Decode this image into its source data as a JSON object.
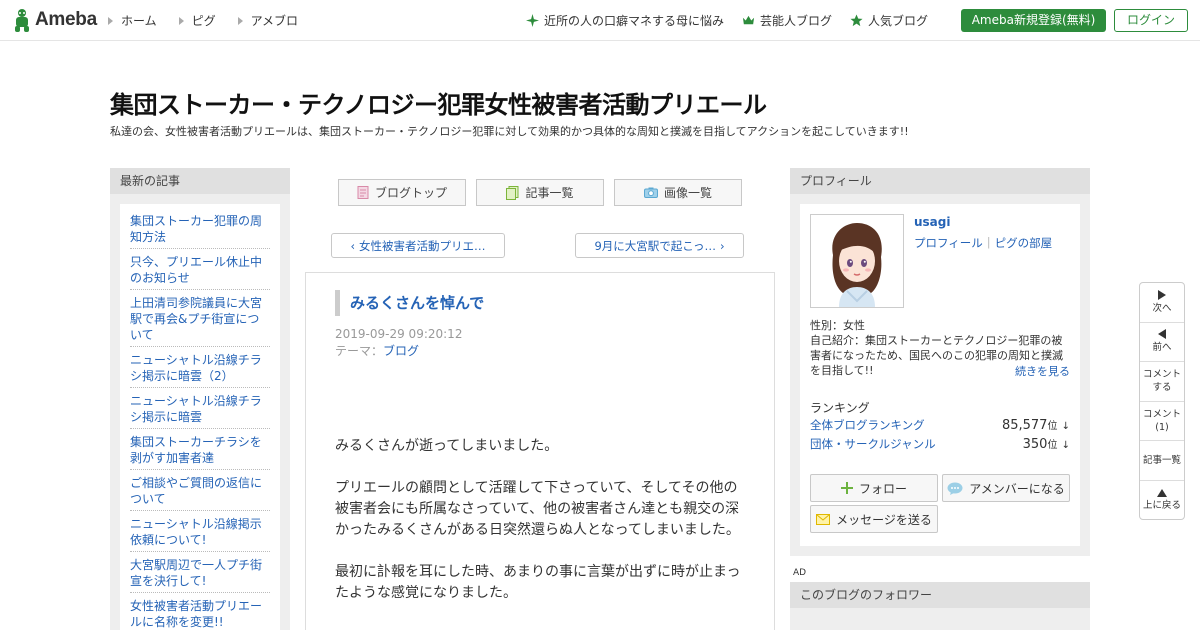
{
  "header": {
    "logo_text": "Ameba",
    "nav": [
      "ホーム",
      "ピグ",
      "アメブロ"
    ],
    "links": [
      {
        "icon": "sparkle-icon",
        "label": "近所の人の口癖マネする母に悩み"
      },
      {
        "icon": "crown-icon",
        "label": "芸能人ブログ"
      },
      {
        "icon": "star-icon",
        "label": "人気ブログ"
      }
    ],
    "register_label": "Ameba新規登録(無料)",
    "login_label": "ログイン",
    "accent_color": "#2d8c3c"
  },
  "blog": {
    "title": "集団ストーカー・テクノロジー犯罪女性被害者活動プリエール",
    "description": "私達の会、女性被害者活動プリエールは、集団ストーカー・テクノロジー犯罪に対して効果的かつ具体的な周知と撲滅を目指してアクションを起こしていきます!!"
  },
  "left_sidebar": {
    "heading": "最新の記事",
    "items": [
      "集団ストーカー犯罪の周知方法",
      "只今、プリエール休止中のお知らせ",
      "上田清司参院議員に大宮駅で再会&プチ街宣について",
      "ニューシャトル沿線チラシ掲示に暗雲（2）",
      "ニューシャトル沿線チラシ掲示に暗雲",
      "集団ストーカーチラシを剥がす加害者達",
      "ご相談やご質問の返信について",
      "ニューシャトル沿線掲示依頼について!",
      "大宮駅周辺で一人プチ街宣を決行して!",
      "女性被害者活動プリエールに名称を変更!!"
    ]
  },
  "tabs": [
    {
      "icon": "document-icon",
      "label": "ブログトップ"
    },
    {
      "icon": "list-icon",
      "label": "記事一覧"
    },
    {
      "icon": "camera-icon",
      "label": "画像一覧"
    }
  ],
  "pager": {
    "prev": "女性被害者活動プリエ…",
    "next": "9月に大宮駅で起こっ…"
  },
  "article": {
    "title": "みるくさんを悼んで",
    "date": "2019-09-29 09:20:12",
    "theme_label": "テーマ：",
    "theme": "ブログ",
    "paragraphs": [
      "みるくさんが逝ってしまいました。",
      "プリエールの顧問として活躍して下さっていて、そしてその他の被害者会にも所属なさっていて、他の被害者さん達とも親交の深かったみるくさんがある日突然還らぬ人となってしまいました。",
      "最初に訃報を耳にした時、あまりの事に言葉が出ずに時が止まったような感覚になりました。"
    ]
  },
  "profile": {
    "heading": "プロフィール",
    "name": "usagi",
    "link_profile": "プロフィール",
    "link_sep": "|",
    "link_room": "ピグの部屋",
    "gender": "性別：女性",
    "intro": "自己紹介：集団ストーカーとテクノロジー犯罪の被害者になったため、国民へのこの犯罪の周知と撲滅を目指して!!",
    "more": "続きを見る",
    "ranking_heading": "ランキング",
    "rankings": [
      {
        "label": "全体ブログランキング",
        "value": "85,577",
        "unit": "位",
        "arrow": "↓"
      },
      {
        "label": "団体・サークルジャンル",
        "value": "350",
        "unit": "位",
        "arrow": "↓"
      }
    ],
    "follow_label": "フォロー",
    "amember_label": "アメンバーになる",
    "message_label": "メッセージを送る"
  },
  "ad_label": "AD",
  "followers_heading": "このブログのフォロワー",
  "float_nav": [
    {
      "icon": "arrow-right-icon",
      "label": "次へ"
    },
    {
      "icon": "arrow-left-icon",
      "label": "前へ"
    },
    {
      "icon": "",
      "label": "コメント\nする"
    },
    {
      "icon": "",
      "label": "コメント\n(1)"
    },
    {
      "icon": "",
      "label": "記事一覧"
    },
    {
      "icon": "arrow-up-icon",
      "label": "上に戻る"
    }
  ]
}
